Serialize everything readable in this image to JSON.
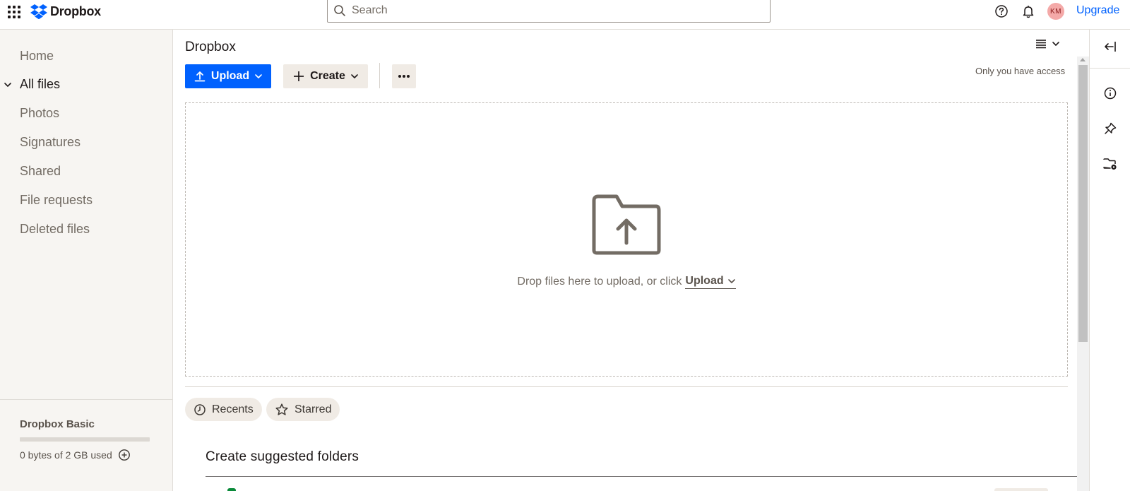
{
  "topbar": {
    "app_name": "Dropbox",
    "search_placeholder": "Search",
    "avatar_initials": "KM",
    "upgrade_label": "Upgrade",
    "icons": [
      "app-grid-icon",
      "dropbox-logo-icon",
      "search-icon",
      "help-icon",
      "bell-icon"
    ]
  },
  "sidebar": {
    "items": [
      {
        "label": "Home"
      },
      {
        "label": "All files",
        "active": true
      },
      {
        "label": "Photos"
      },
      {
        "label": "Signatures"
      },
      {
        "label": "Shared"
      },
      {
        "label": "File requests"
      },
      {
        "label": "Deleted files"
      }
    ],
    "plan_name": "Dropbox Basic",
    "plan_usage": "0 bytes of 2 GB used",
    "plan_used_fraction": 0.0
  },
  "main": {
    "folder_title": "Dropbox",
    "access_note": "Only you have access",
    "upload_label": "Upload",
    "create_label": "Create",
    "dropzone_text": "Drop files here to upload, or click",
    "dropzone_upload": "Upload",
    "chips": [
      {
        "label": "Recents",
        "icon": "clock-icon"
      },
      {
        "label": "Starred",
        "icon": "star-icon"
      }
    ],
    "suggested_title": "Create suggested folders"
  },
  "right_rail": {
    "icons": [
      "collapse-panel-icon",
      "info-icon",
      "pin-icon",
      "folder-settings-icon"
    ]
  },
  "colors": {
    "accent": "#0061fe",
    "sidebar_bg": "#f7f5f2",
    "chip_bg": "#f0ebe5",
    "text": "#1e1919",
    "muted": "#736c64"
  }
}
